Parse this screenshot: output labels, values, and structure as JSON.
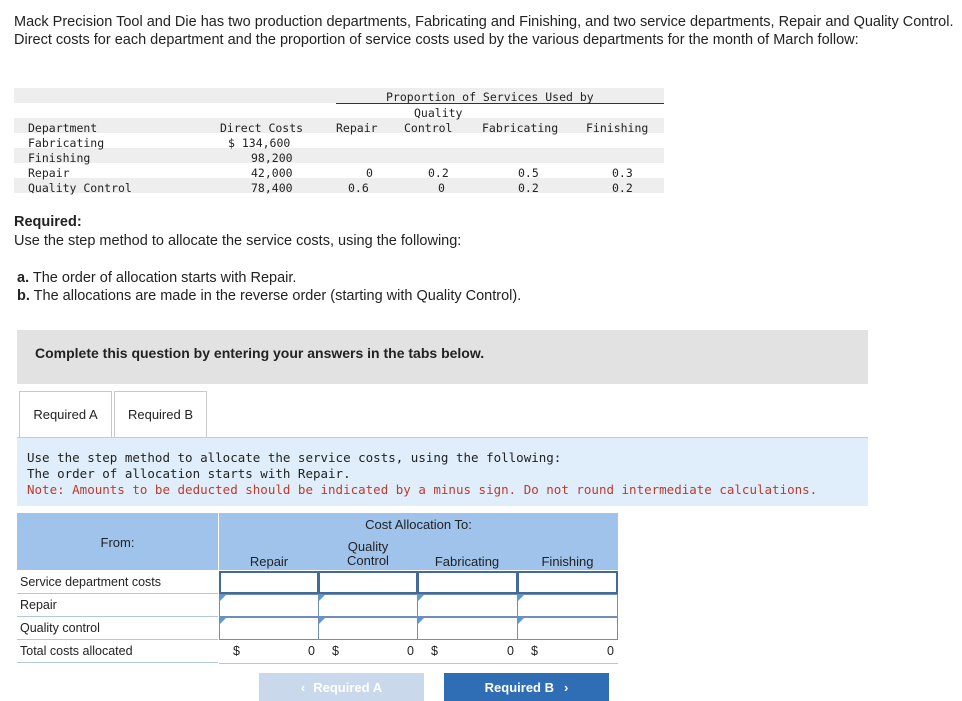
{
  "intro": "Mack Precision Tool and Die has two production departments, Fabricating and Finishing, and two service departments, Repair and Quality Control. Direct costs for each department and the proportion of service costs used by the various departments for the month of March follow:",
  "data_table": {
    "proportion_header": "Proportion of Services Used by",
    "col_department": "Department",
    "col_direct_costs": "Direct Costs",
    "col_repair": "Repair",
    "col_qc_line1": "Quality",
    "col_qc_line2": "Control",
    "col_fabricating": "Fabricating",
    "col_finishing": "Finishing",
    "rows": [
      {
        "dept": "Fabricating",
        "cost": "$ 134,600",
        "repair": "",
        "qc": "",
        "fab": "",
        "fin": ""
      },
      {
        "dept": "Finishing",
        "cost": "98,200",
        "repair": "",
        "qc": "",
        "fab": "",
        "fin": ""
      },
      {
        "dept": "Repair",
        "cost": "42,000",
        "repair": "0",
        "qc": "0.2",
        "fab": "0.5",
        "fin": "0.3"
      },
      {
        "dept": "Quality Control",
        "cost": "78,400",
        "repair": "0.6",
        "qc": "0",
        "fab": "0.2",
        "fin": "0.2"
      }
    ]
  },
  "required": {
    "title": "Required:",
    "text": "Use the step method to allocate the service costs, using the following:",
    "a_label": "a.",
    "a_text": "The order of allocation starts with Repair.",
    "b_label": "b.",
    "b_text": "The allocations are made in the reverse order (starting with Quality Control)."
  },
  "banner": "Complete this question by entering your answers in the tabs below.",
  "tabs": {
    "a": "Required A",
    "b": "Required B"
  },
  "instructions": {
    "line1": "Use the step method to allocate the service costs, using the following:",
    "line2": "The order of allocation starts with Repair.",
    "note": "Note: Amounts to be deducted should be indicated by a minus sign. Do not round intermediate calculations."
  },
  "grid": {
    "from_label": "From:",
    "cost_alloc_label": "Cost Allocation To:",
    "col_repair": "Repair",
    "col_qc_line1": "Quality",
    "col_qc_line2": "Control",
    "col_fabricating": "Fabricating",
    "col_finishing": "Finishing",
    "row_service": "Service department costs",
    "row_repair": "Repair",
    "row_qc": "Quality control",
    "row_total": "Total costs allocated",
    "currency": "$",
    "totals": [
      "0",
      "0",
      "0",
      "0"
    ]
  },
  "nav": {
    "prev": "Required A",
    "next": "Required B"
  }
}
